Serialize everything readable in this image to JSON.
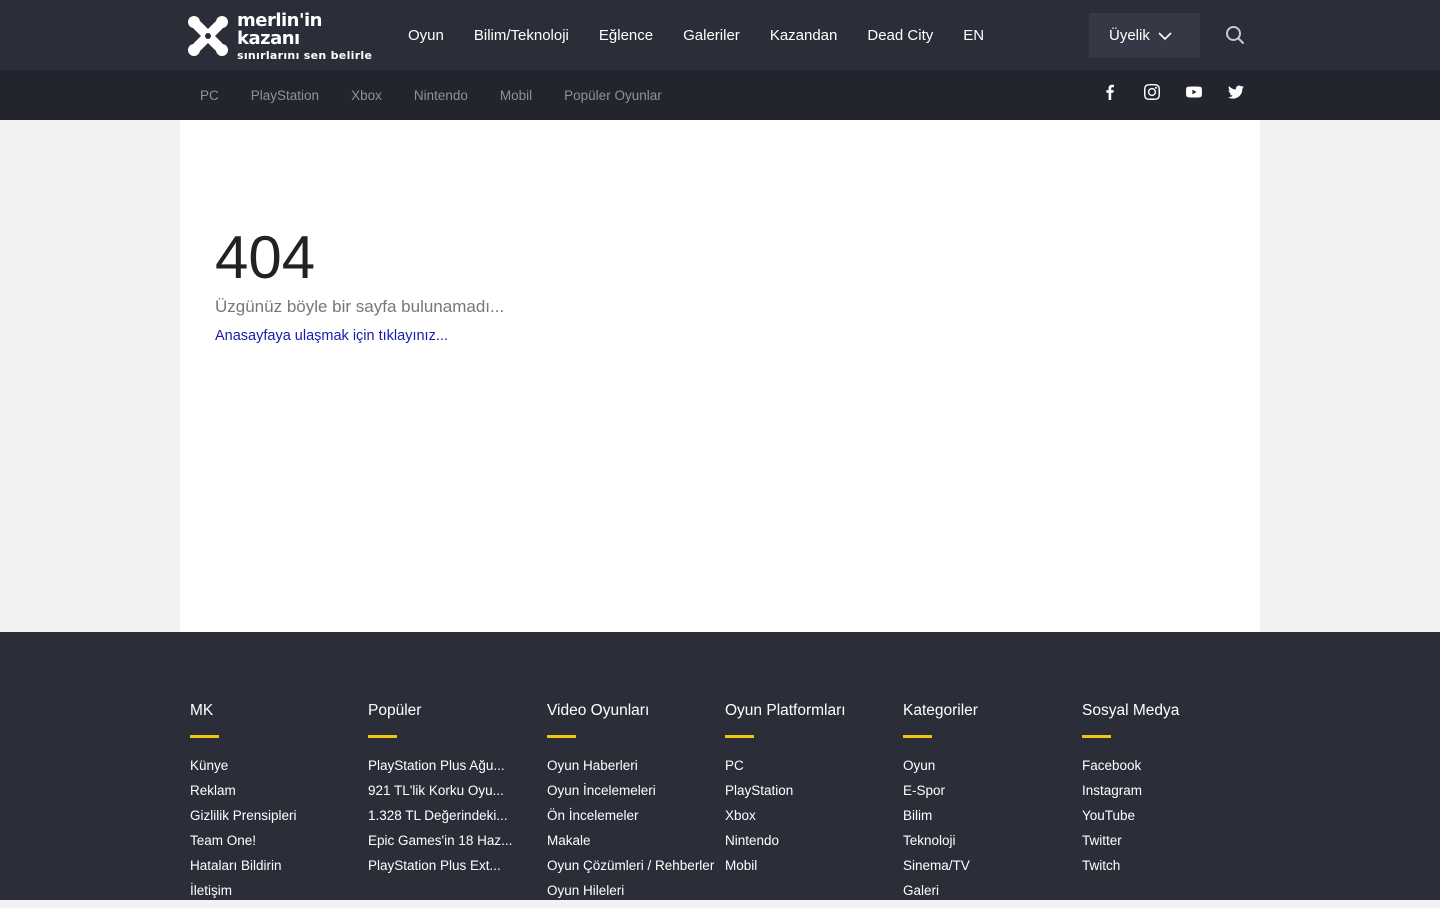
{
  "brand": {
    "name": "merlin'in kazanı",
    "tagline": "sınırlarını sen belirle"
  },
  "main_nav": [
    "Oyun",
    "Bilim/Teknoloji",
    "Eğlence",
    "Galeriler",
    "Kazandan",
    "Dead City",
    "EN"
  ],
  "membership_label": "Üyelik",
  "sub_nav": [
    "PC",
    "PlayStation",
    "Xbox",
    "Nintendo",
    "Mobil",
    "Popüler Oyunlar"
  ],
  "social_icons": [
    "facebook-icon",
    "instagram-icon",
    "youtube-icon",
    "twitter-icon"
  ],
  "error": {
    "code": "404",
    "message": "Üzgünüz böyle bir sayfa bulunamadı...",
    "link": "Anasayfaya ulaşmak için tıklayınız..."
  },
  "footer": {
    "accent_color": "#f1c40f",
    "columns": [
      {
        "title": "MK",
        "items": [
          "Künye",
          "Reklam",
          "Gizlilik Prensipleri",
          "Team One!",
          "Hataları Bildirin",
          "İletişim"
        ]
      },
      {
        "title": "Popüler",
        "items": [
          "PlayStation Plus Ağu...",
          "921 TL'lik Korku Oyu...",
          "1.328 TL Değerindeki...",
          "Epic Games'in 18 Haz...",
          "PlayStation Plus Ext..."
        ]
      },
      {
        "title": "Video Oyunları",
        "items": [
          "Oyun Haberleri",
          "Oyun İncelemeleri",
          "Ön İncelemeler",
          "Makale",
          "Oyun Çözümleri / Rehberler",
          "Oyun Hileleri"
        ]
      },
      {
        "title": "Oyun Platformları",
        "items": [
          "PC",
          "PlayStation",
          "Xbox",
          "Nintendo",
          "Mobil"
        ]
      },
      {
        "title": "Kategoriler",
        "items": [
          "Oyun",
          "E-Spor",
          "Bilim",
          "Teknoloji",
          "Sinema/TV",
          "Galeri"
        ]
      },
      {
        "title": "Sosyal Medya",
        "items": [
          "Facebook",
          "Instagram",
          "YouTube",
          "Twitter",
          "Twitch"
        ]
      }
    ]
  }
}
